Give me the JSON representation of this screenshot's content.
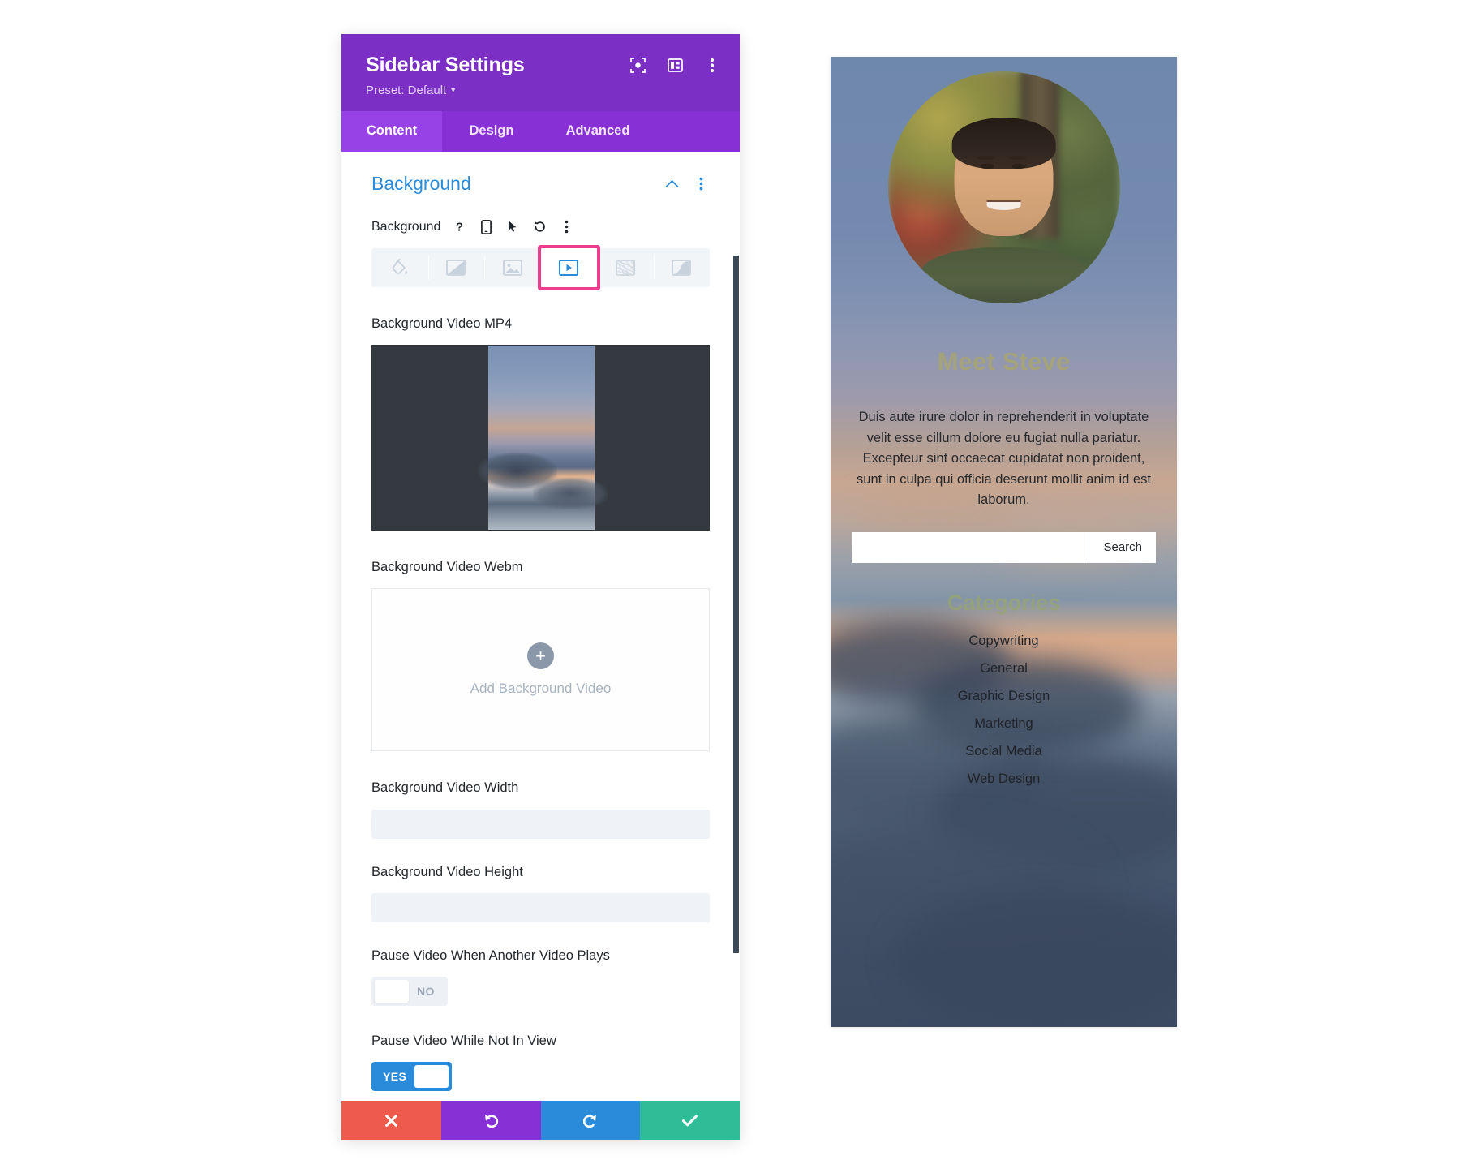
{
  "panel": {
    "title": "Sidebar Settings",
    "preset": "Preset: Default",
    "header_icons": [
      {
        "name": "focus-icon"
      },
      {
        "name": "layout-toggle-icon"
      },
      {
        "name": "more-options-icon"
      }
    ],
    "tabs": [
      {
        "label": "Content",
        "active": true
      },
      {
        "label": "Design",
        "active": false
      },
      {
        "label": "Advanced",
        "active": false
      }
    ],
    "section": {
      "title": "Background",
      "collapse_icon": "chevron-up-icon",
      "menu_icon": "more-options-icon"
    },
    "background_field": {
      "label": "Background",
      "icons": [
        {
          "name": "help-icon",
          "glyph": "?"
        },
        {
          "name": "responsive-icon"
        },
        {
          "name": "hover-cursor-icon"
        },
        {
          "name": "reset-icon"
        },
        {
          "name": "more-options-icon"
        }
      ],
      "types": [
        {
          "name": "background-color",
          "selected": false
        },
        {
          "name": "background-gradient",
          "selected": false
        },
        {
          "name": "background-image",
          "selected": false
        },
        {
          "name": "background-video",
          "selected": true
        },
        {
          "name": "background-pattern",
          "selected": false
        },
        {
          "name": "background-mask",
          "selected": false
        }
      ],
      "selected_highlight_color": "#EE3D8F",
      "selected_icon_color": "#2A8BDA"
    },
    "fields": {
      "mp4_label": "Background Video MP4",
      "webm_label": "Background Video Webm",
      "dropzone_text": "Add Background Video",
      "width_label": "Background Video Width",
      "width_value": "",
      "height_label": "Background Video Height",
      "height_value": "",
      "pause_another_label": "Pause Video When Another Video Plays",
      "pause_another_state": "NO",
      "pause_notinview_label": "Pause Video While Not In View",
      "pause_notinview_state": "YES"
    },
    "actions": [
      {
        "name": "cancel-button",
        "icon": "close-icon",
        "color": "#EE5B4D"
      },
      {
        "name": "undo-button",
        "icon": "undo-icon",
        "color": "#8730D6"
      },
      {
        "name": "redo-button",
        "icon": "redo-icon",
        "color": "#2A8BDA"
      },
      {
        "name": "save-button",
        "icon": "check-icon",
        "color": "#2EBD97"
      }
    ]
  },
  "preview": {
    "avatar_alt": "profile-photo",
    "heading": "Meet Steve",
    "body": "Duis aute irure dolor in reprehenderit in voluptate velit esse cillum dolore eu fugiat nulla pariatur. Excepteur sint occaecat cupidatat non proident, sunt in culpa qui officia deserunt mollit anim id est laborum.",
    "search_value": "",
    "search_placeholder": "",
    "search_button": "Search",
    "categories_title": "Categories",
    "categories": [
      "Copywriting",
      "General",
      "Graphic Design",
      "Marketing",
      "Social Media",
      "Web Design"
    ]
  }
}
